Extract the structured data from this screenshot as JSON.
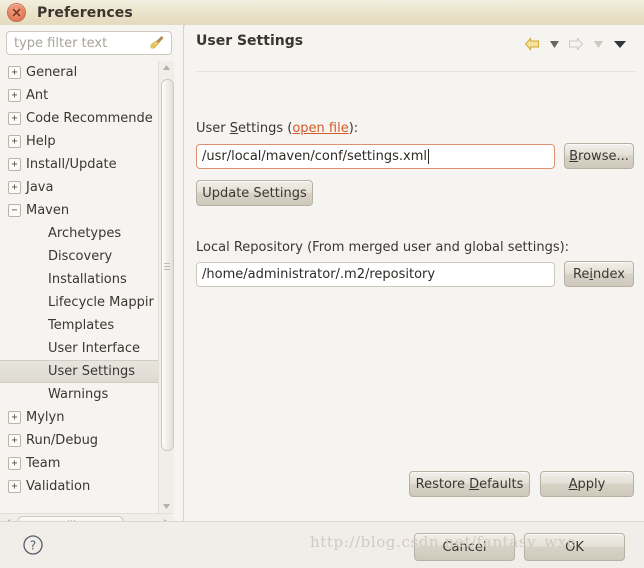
{
  "window": {
    "title": "Preferences",
    "close_icon": "close-icon"
  },
  "sidebar": {
    "filter": {
      "placeholder": "type filter text",
      "value": "",
      "clear_icon": "broom-icon"
    },
    "items": [
      {
        "label": "General",
        "expander": "+",
        "level": 0,
        "selected": false
      },
      {
        "label": "Ant",
        "expander": "+",
        "level": 0,
        "selected": false
      },
      {
        "label": "Code Recommende",
        "expander": "+",
        "level": 0,
        "selected": false
      },
      {
        "label": "Help",
        "expander": "+",
        "level": 0,
        "selected": false
      },
      {
        "label": "Install/Update",
        "expander": "+",
        "level": 0,
        "selected": false
      },
      {
        "label": "Java",
        "expander": "+",
        "level": 0,
        "selected": false
      },
      {
        "label": "Maven",
        "expander": "−",
        "level": 0,
        "selected": false
      },
      {
        "label": "Archetypes",
        "expander": "",
        "level": 1,
        "selected": false
      },
      {
        "label": "Discovery",
        "expander": "",
        "level": 1,
        "selected": false
      },
      {
        "label": "Installations",
        "expander": "",
        "level": 1,
        "selected": false
      },
      {
        "label": "Lifecycle Mappir",
        "expander": "",
        "level": 1,
        "selected": false
      },
      {
        "label": "Templates",
        "expander": "",
        "level": 1,
        "selected": false
      },
      {
        "label": "User Interface",
        "expander": "",
        "level": 1,
        "selected": false
      },
      {
        "label": "User Settings",
        "expander": "",
        "level": 1,
        "selected": true
      },
      {
        "label": "Warnings",
        "expander": "",
        "level": 1,
        "selected": false
      },
      {
        "label": "Mylyn",
        "expander": "+",
        "level": 0,
        "selected": false
      },
      {
        "label": "Run/Debug",
        "expander": "+",
        "level": 0,
        "selected": false
      },
      {
        "label": "Team",
        "expander": "+",
        "level": 0,
        "selected": false
      },
      {
        "label": "Validation",
        "expander": "+",
        "level": 0,
        "selected": false
      }
    ]
  },
  "content": {
    "title": "User Settings",
    "nav": [
      {
        "name": "back-arrow-icon",
        "state": "enabled"
      },
      {
        "name": "back-dropdown-icon",
        "state": "enabled"
      },
      {
        "name": "forward-arrow-icon",
        "state": "disabled"
      },
      {
        "name": "forward-dropdown-icon",
        "state": "disabled"
      },
      {
        "name": "view-menu-icon",
        "state": "enabled"
      }
    ],
    "user_settings": {
      "label_prefix": "User ",
      "label_accesskey": "S",
      "label_mid": "ettings (",
      "link": "open file",
      "label_suffix": "):",
      "value": "/usr/local/maven/conf/settings.xml",
      "browse_prefix": "",
      "browse_accesskey": "B",
      "browse_suffix": "rowse...",
      "update_label": "Update Settings"
    },
    "local_repository": {
      "label": "Local Repository (From merged user and global settings):",
      "value": "/home/administrator/.m2/repository",
      "reindex_prefix": "Re",
      "reindex_accesskey": "i",
      "reindex_suffix": "ndex"
    },
    "restore_defaults": {
      "prefix": "Restore ",
      "accesskey": "D",
      "suffix": "efaults"
    },
    "apply": {
      "prefix": "",
      "accesskey": "A",
      "suffix": "pply"
    }
  },
  "footer": {
    "help_icon": "help-icon",
    "cancel_label": "Cancel",
    "ok_label": "OK"
  },
  "watermark": {
    "text": "http://blog.csdn.net/fantasy_wxe"
  },
  "colors": {
    "titlebar": "#eae3c9",
    "accent_link": "#d35b28",
    "focus_border": "#e09070",
    "selection": "#dedad2"
  }
}
